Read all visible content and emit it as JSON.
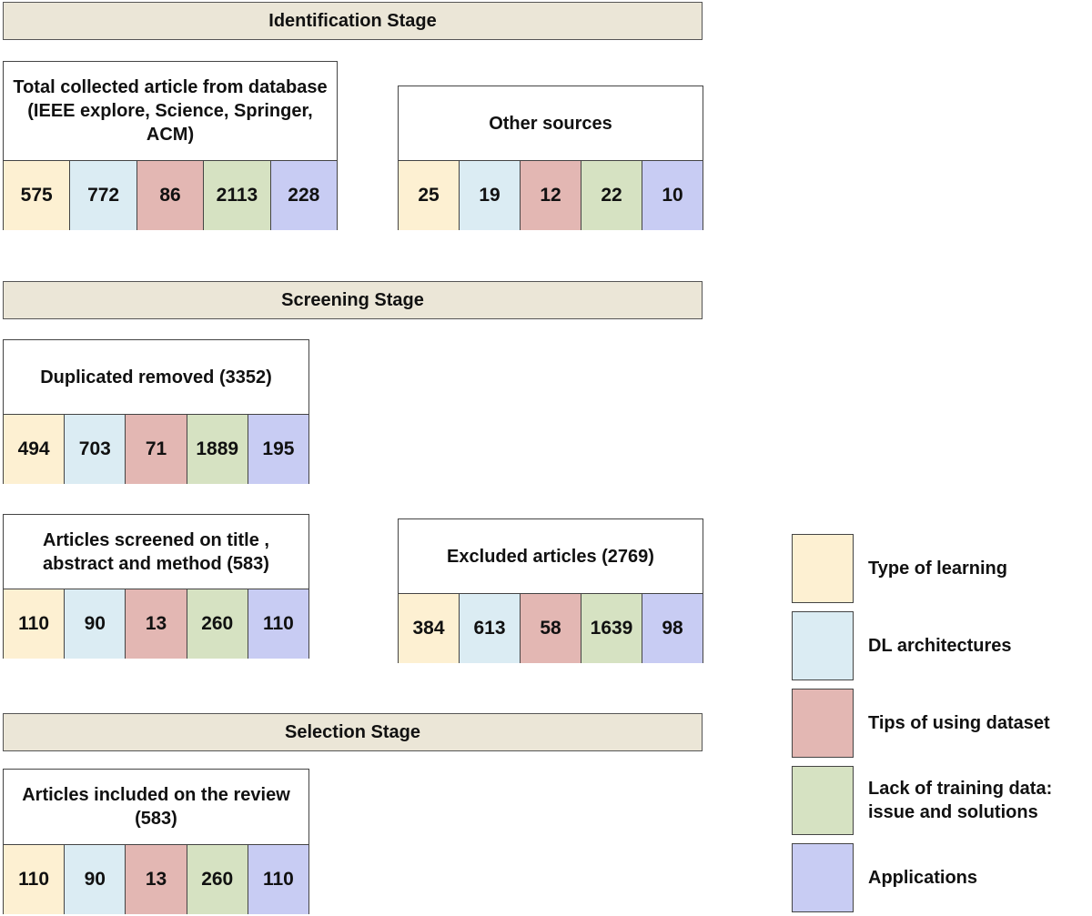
{
  "legend": [
    {
      "label": "Type of learning",
      "color": "#fdf0d2"
    },
    {
      "label": "DL architectures",
      "color": "#dbecf3"
    },
    {
      "label": "Tips of using dataset",
      "color": "#e3b7b3"
    },
    {
      "label": "Lack of training data: issue and solutions",
      "color": "#d6e2c2"
    },
    {
      "label": "Applications",
      "color": "#c8ccf3"
    }
  ],
  "stages": {
    "identification": "Identification Stage",
    "screening": "Screening Stage",
    "selection": "Selection Stage"
  },
  "boxes": {
    "total_collected": {
      "title": "Total collected article from database (IEEE explore, Science, Springer, ACM)",
      "values": [
        "575",
        "772",
        "86",
        "2113",
        "228"
      ]
    },
    "other_sources": {
      "title": "Other sources",
      "values": [
        "25",
        "19",
        "12",
        "22",
        "10"
      ]
    },
    "duplicates_removed": {
      "title": "Duplicated removed (3352)",
      "values": [
        "494",
        "703",
        "71",
        "1889",
        "195"
      ]
    },
    "screened": {
      "title": "Articles screened on title , abstract and method (583)",
      "values": [
        "110",
        "90",
        "13",
        "260",
        "110"
      ]
    },
    "excluded": {
      "title": "Excluded articles (2769)",
      "values": [
        "384",
        "613",
        "58",
        "1639",
        "98"
      ]
    },
    "included": {
      "title": "Articles included on the review (583)",
      "values": [
        "110",
        "90",
        "13",
        "260",
        "110"
      ]
    }
  }
}
